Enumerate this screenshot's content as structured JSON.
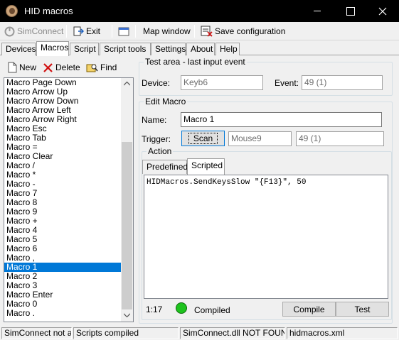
{
  "window": {
    "title": "HID macros"
  },
  "toolbar": {
    "simconnect_label": "SimConnect",
    "exit_label": "Exit",
    "map_window_label": "Map window",
    "save_config_label": "Save configuration"
  },
  "tabs": [
    "Devices",
    "Macros",
    "Script",
    "Script tools",
    "Settings",
    "About",
    "Help"
  ],
  "active_tab": "Macros",
  "macros_toolbar": {
    "new_label": "New",
    "delete_label": "Delete",
    "find_label": "Find"
  },
  "macro_list": {
    "items": [
      "Macro Page Down",
      "Macro Arrow Up",
      "Macro Arrow Down",
      "Macro Arrow Left",
      "Macro Arrow Right",
      "Macro Esc",
      "Macro Tab",
      "Macro =",
      "Macro Clear",
      "Macro /",
      "Macro *",
      "Macro -",
      "Macro 7",
      "Macro 8",
      "Macro 9",
      "Macro +",
      "Macro 4",
      "Macro 5",
      "Macro 6",
      "Macro ,",
      "Macro 1",
      "Macro 2",
      "Macro 3",
      "Macro Enter",
      "Macro 0",
      "Macro ."
    ],
    "selected": "Macro 1"
  },
  "test_area": {
    "title": "Test area - last input event",
    "device_label": "Device:",
    "device_value": "Keyb6",
    "event_label": "Event:",
    "event_value": "49  (1)"
  },
  "edit_macro": {
    "title": "Edit Macro",
    "name_label": "Name:",
    "name_value": "Macro 1",
    "trigger_label": "Trigger:",
    "scan_label": "Scan",
    "trigger_device": "Mouse9",
    "trigger_event": "49  (1)"
  },
  "action": {
    "title": "Action",
    "tabs": [
      "Predefined",
      "Scripted"
    ],
    "active_tab": "Scripted",
    "script": "HIDMacros.SendKeysSlow \"{F13}\", 50",
    "position": "1:17",
    "status_text": "Compiled",
    "status_color": "#1ec31e",
    "compile_label": "Compile",
    "test_label": "Test"
  },
  "statusbar": [
    "SimConnect not av",
    "Scripts compiled",
    "SimConnect.dll NOT FOUND",
    "hidmacros.xml"
  ]
}
